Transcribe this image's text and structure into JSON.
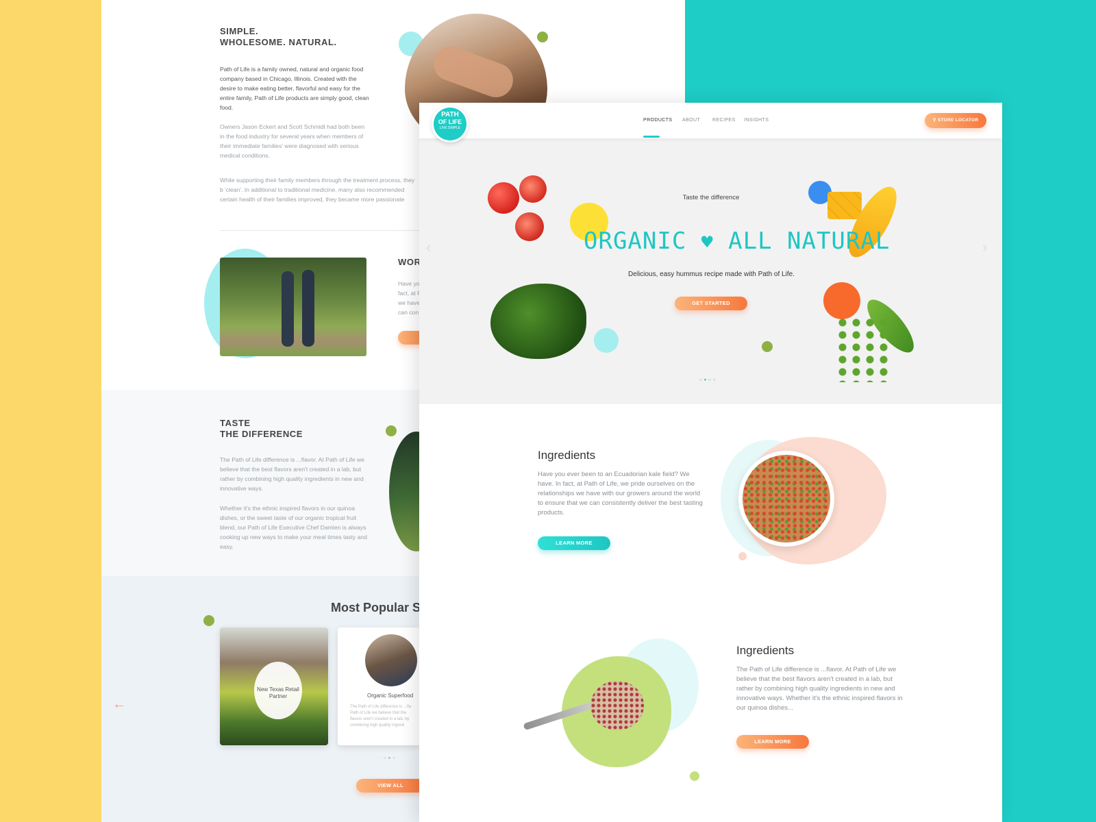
{
  "about": {
    "heading_line1": "SIMPLE.",
    "heading_line2": "WHOLESOME. NATURAL.",
    "para1": "Path of Life is a family owned, natural and organic food company based in Chicago, Illinois. Created with the desire to make eating better, flavorful and easy for the entire family, Path of Life products are simply good, clean food.",
    "para2": "Owners Jason Eckert and Scott Schmidt had both been in the food industry for several years when members of their immediate families' were diagnosed with serious medical conditions.",
    "para3": "While supporting their family members through the treatment process, they b 'clean'. In additional to traditional medicine, many also recommended certain health of their families improved, they became more passionate about providi"
  },
  "work_section": {
    "heading_fragment": "WOR",
    "text_lines": [
      "Have yo",
      "fact, at F",
      "we have",
      "can con"
    ]
  },
  "taste": {
    "heading_line1": "TASTE",
    "heading_line2": "THE DIFFERENCE",
    "para1": "The Path of Life difference is ...flavor. At Path of Life we believe that the best flavors aren't created in a lab, but rather by combining high quality ingredients in new and innovative ways.",
    "para2": "Whether it's the ethnic inspired flavors in our quinoa dishes, or the sweet taste of our organic tropical fruit blend, our Path of Life Executive Chef Damien is always cooking up new ways to make your meal times tasty and easy."
  },
  "popular": {
    "heading": "Most Popular S",
    "cards": [
      {
        "label": "New Texas Retail Partner"
      },
      {
        "label": "Organic Superfood",
        "text": "The Path of Life difference is ...fla Path of Life we believe that the flavors aren't created in a lab, by combining high quality ingredi"
      }
    ],
    "view_all": "VIEW ALL",
    "prev_arrow": "←"
  },
  "front": {
    "logo": {
      "line1": "PATH",
      "line2": "OF LIFE",
      "line3": "LIVE SIMPLE"
    },
    "nav": [
      "PRODUCTS",
      "ABOUT",
      "RECIPES",
      "INSIGHTS"
    ],
    "store_locator": "STORE LOCATOR",
    "hero": {
      "kicker": "Taste the difference",
      "title_left": "ORGANIC",
      "title_right": "ALL NATURAL",
      "subtitle": "Delicious, easy hummus recipe made with Path of Life.",
      "cta": "GET STARTED",
      "left_arrow": "‹",
      "right_arrow": "›"
    },
    "section1": {
      "heading": "Ingredients",
      "text": "Have you ever been to an Ecuadorian kale field? We have. In fact, at Path of Life, we pride ourselves on the relationships we have with our growers around the world to ensure that we can consistently deliver the best tasting products.",
      "button": "LEARN MORE"
    },
    "section2": {
      "heading": "Ingredients",
      "text": "The Path of Life difference is ...flavor. At Path of Life we believe that the best flavors aren't created in a lab, but rather by combining high quality ingredients in new and innovative ways. Whether it's the ethnic inspired flavors in our quinoa dishes...",
      "button": "LEARN MORE"
    }
  },
  "colors": {
    "yellow": "#fcd86a",
    "teal": "#1ecdc6",
    "orange": "#f7783d",
    "accent_green": "#8fb045"
  }
}
